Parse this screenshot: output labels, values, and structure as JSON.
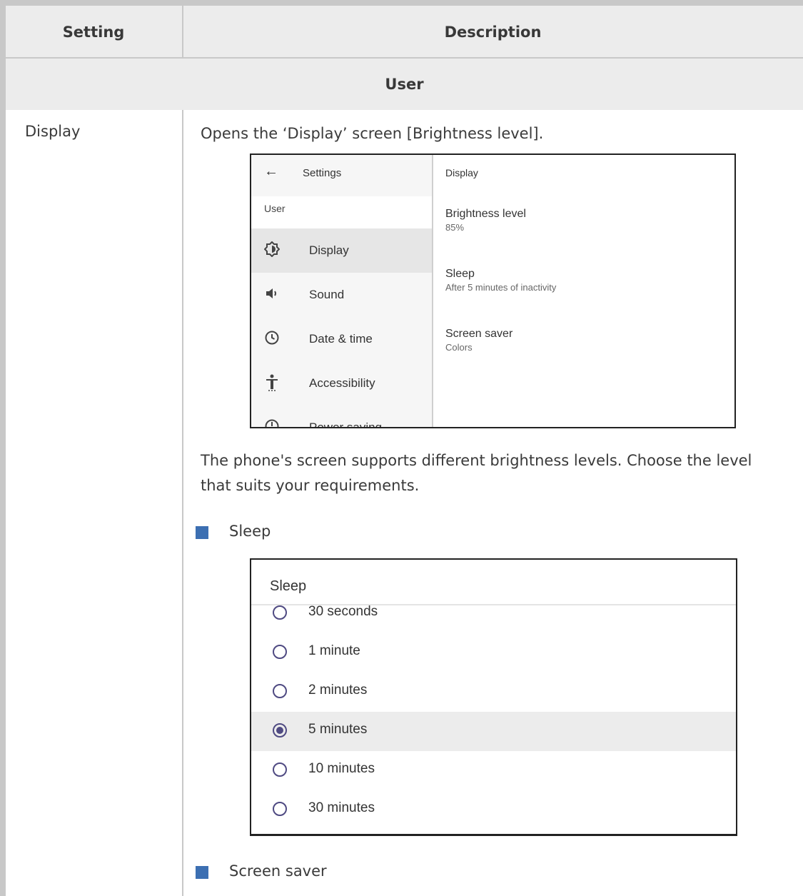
{
  "table": {
    "header": {
      "setting": "Setting",
      "description": "Description"
    },
    "group": "User",
    "row": {
      "setting": "Display",
      "intro": "Opens the ‘Display’ screen [Brightness level].",
      "body": "The phone's screen supports different brightness levels. Choose the level that suits your requirements.",
      "bullets": [
        "Sleep",
        "Screen saver"
      ]
    }
  },
  "display_screen": {
    "nav_title": "Settings",
    "section": "User",
    "menu": [
      {
        "label": "Display",
        "icon": "brightness-icon",
        "selected": true
      },
      {
        "label": "Sound",
        "icon": "speaker-icon",
        "selected": false
      },
      {
        "label": "Date & time",
        "icon": "clock-icon",
        "selected": false
      },
      {
        "label": "Accessibility",
        "icon": "accessibility-icon",
        "selected": false
      },
      {
        "label": "Power saving",
        "icon": "power-icon",
        "selected": false
      }
    ],
    "panel_title": "Display",
    "settings": [
      {
        "title": "Brightness level",
        "value": "85%"
      },
      {
        "title": "Sleep",
        "value": "After 5 minutes of inactivity"
      },
      {
        "title": "Screen saver",
        "value": "Colors"
      }
    ]
  },
  "sleep_dialog": {
    "title": "Sleep",
    "options": [
      {
        "label": "30 seconds",
        "selected": false
      },
      {
        "label": "1 minute",
        "selected": false
      },
      {
        "label": "2 minutes",
        "selected": false
      },
      {
        "label": "5 minutes",
        "selected": true
      },
      {
        "label": "10 minutes",
        "selected": false
      },
      {
        "label": "30 minutes",
        "selected": false
      }
    ]
  },
  "colors": {
    "bullet": "#3c6fb2",
    "radio": "#4f4a82",
    "header_bg": "#ececec"
  }
}
